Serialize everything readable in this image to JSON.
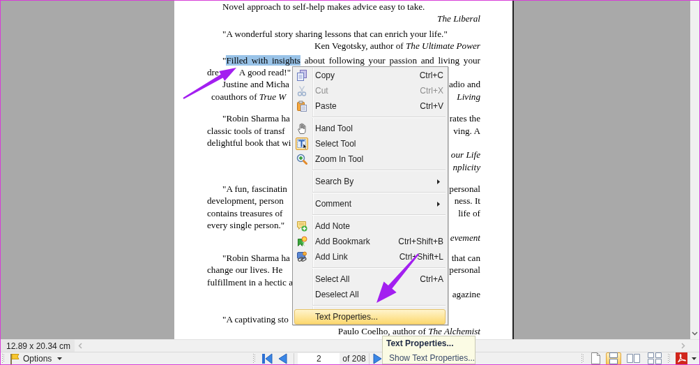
{
  "document": {
    "blocks": [
      {
        "lines": [
          {
            "kind": "indent",
            "left": "Novel approach to self-help makes advice easy to take."
          },
          {
            "kind": "credit",
            "right": {
              "text": "The Liberal",
              "italic": true
            }
          }
        ]
      },
      {
        "lines": [
          {
            "kind": "indent",
            "left": "\"A wonderful story sharing lessons that can enrich your life.\""
          },
          {
            "kind": "credit",
            "right": {
              "text": "Ken Vegotsky, author of *The Ultimate Power*",
              "italic": false
            }
          }
        ]
      },
      {
        "lines": [
          {
            "kind": "indent",
            "spans": [
              {
                "text": "\"",
                "selected": false
              },
              {
                "text": "Filled with insights",
                "selected": true
              },
              {
                "text": " about following your passion and living your",
                "selected": false
              }
            ]
          },
          {
            "kind": "flush",
            "left": "dre",
            "after": "A good read!\""
          },
          {
            "kind": "indent",
            "left": "Justine and Micha",
            "right": {
              "text": "adio and",
              "italic": false
            }
          },
          {
            "kind": "credit",
            "left": "coauthors of *True W*",
            "right": {
              "text": "Living",
              "italic": true
            }
          }
        ]
      },
      {
        "lines": [
          {
            "kind": "indent",
            "left": "\"Robin Sharma ha",
            "right": {
              "text": "rates the",
              "italic": false
            }
          },
          {
            "kind": "flush",
            "left": "classic tools of transf",
            "right": {
              "text": "ving. A",
              "italic": false
            }
          },
          {
            "kind": "flush",
            "left": "delightful book that wi"
          },
          {
            "kind": "credit",
            "right": {
              "text": "our Life",
              "italic": true
            }
          },
          {
            "kind": "credit",
            "right": {
              "text": "nplicity",
              "italic": true
            }
          }
        ]
      },
      {
        "lines": [
          {
            "kind": "indent",
            "left": "\"A fun, fascinatin",
            "right": {
              "text": "personal",
              "italic": false
            }
          },
          {
            "kind": "flush",
            "left": "development, person",
            "right": {
              "text": "ness. It",
              "italic": false
            }
          },
          {
            "kind": "flush",
            "left": "contains treasures of",
            "right": {
              "text": "life of",
              "italic": false
            }
          },
          {
            "kind": "flush",
            "left": "every single person.\""
          },
          {
            "kind": "credit",
            "right": {
              "text": "evement",
              "italic": true
            }
          }
        ]
      },
      {
        "lines": [
          {
            "kind": "indent",
            "left": "\"Robin Sharma ha",
            "right": {
              "text": "that can",
              "italic": false
            }
          },
          {
            "kind": "flush",
            "left": "change our lives. He",
            "right": {
              "text": "personal",
              "italic": false
            }
          },
          {
            "kind": "flush",
            "left": "fulfillment in a hectic a"
          },
          {
            "kind": "credit",
            "right": {
              "text": "agazine",
              "italic": false
            }
          }
        ]
      },
      {
        "lines": [
          {
            "kind": "indent",
            "left": "\"A captivating sto"
          },
          {
            "kind": "credit",
            "right": {
              "text": "Paulo Coelho, author of *The Alchemist*",
              "italic": false
            }
          }
        ]
      }
    ]
  },
  "context_menu": {
    "groups": [
      {
        "items": [
          {
            "label": "Copy",
            "shortcut": "Ctrl+C",
            "disabled": false,
            "selected": false
          },
          {
            "label": "Cut",
            "shortcut": "Ctrl+X",
            "disabled": true,
            "selected": false
          },
          {
            "label": "Paste",
            "shortcut": "Ctrl+V",
            "disabled": false,
            "selected": false
          }
        ]
      },
      {
        "items": [
          {
            "label": "Hand Tool",
            "checked": false,
            "disabled": false,
            "selected": false
          },
          {
            "label": "Select Tool",
            "checked": true,
            "disabled": false,
            "selected": false
          },
          {
            "label": "Zoom In Tool",
            "checked": false,
            "disabled": false,
            "selected": false
          }
        ]
      },
      {
        "items": [
          {
            "label": "Search By",
            "submenu": true,
            "disabled": false,
            "selected": false
          }
        ]
      },
      {
        "items": [
          {
            "label": "Comment",
            "submenu": true,
            "disabled": false,
            "selected": false
          }
        ]
      },
      {
        "items": [
          {
            "label": "Add Note",
            "disabled": false,
            "selected": false
          },
          {
            "label": "Add Bookmark",
            "shortcut": "Ctrl+Shift+B",
            "disabled": false,
            "selected": false
          },
          {
            "label": "Add Link",
            "shortcut": "Ctrl+Shift+L",
            "disabled": false,
            "selected": false
          }
        ]
      },
      {
        "items": [
          {
            "label": "Select All",
            "shortcut": "Ctrl+A",
            "disabled": false,
            "selected": false
          },
          {
            "label": "Deselect All",
            "disabled": false,
            "selected": false
          }
        ]
      },
      {
        "items": [
          {
            "label": "Text Properties...",
            "disabled": false,
            "selected": true
          }
        ]
      }
    ]
  },
  "tooltip": {
    "title": "Text Properties...",
    "description": "Show Text Properties..."
  },
  "status_bar": {
    "page_size": "12.89 x 20.34 cm"
  },
  "toolbar": {
    "options": "Options",
    "page_field": {
      "value": "2"
    },
    "page_count": "of 208",
    "view_modes": [
      {
        "selected": false
      },
      {
        "selected": true
      },
      {
        "selected": false
      },
      {
        "selected": false
      }
    ]
  }
}
